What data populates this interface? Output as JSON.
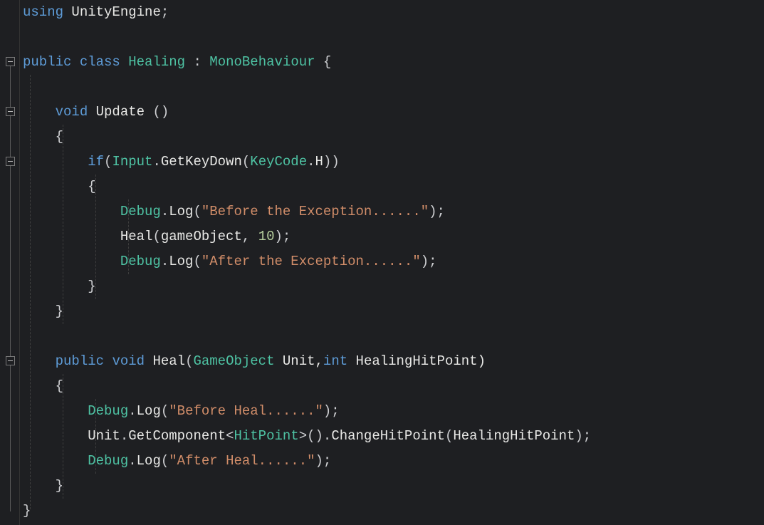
{
  "code": {
    "l1": {
      "using": "using",
      "ns": "UnityEngine",
      "semi": ";"
    },
    "l3": {
      "pub": "public",
      "cls": "class",
      "name": "Healing",
      "colon": " : ",
      "base": "MonoBehaviour",
      "open": " {"
    },
    "l5": {
      "void": "void",
      "name": "Update",
      "parens": " ()"
    },
    "l6": {
      "open": "{"
    },
    "l7": {
      "if": "if",
      "op": "(",
      "input": "Input",
      "dot1": ".",
      "gkd": "GetKeyDown",
      "op2": "(",
      "kc": "KeyCode",
      "dot2": ".",
      "h": "H",
      "close": "))"
    },
    "l8": {
      "open": "{"
    },
    "l9": {
      "dbg": "Debug",
      "dot": ".",
      "log": "Log",
      "op": "(",
      "str": "\"Before the Exception......\"",
      "close": ");"
    },
    "l10": {
      "heal": "Heal",
      "op": "(",
      "go": "gameObject",
      "comma": ", ",
      "num": "10",
      "close": ");"
    },
    "l11": {
      "dbg": "Debug",
      "dot": ".",
      "log": "Log",
      "op": "(",
      "str": "\"After the Exception......\"",
      "close": ");"
    },
    "l12": {
      "close": "}"
    },
    "l13": {
      "close": "}"
    },
    "l15": {
      "pub": "public",
      "void": "void",
      "name": "Heal",
      "op": "(",
      "gotype": "GameObject",
      "p1": " Unit,",
      "inttype": "int",
      "p2": " HealingHitPoint)"
    },
    "l16": {
      "open": "{"
    },
    "l17": {
      "dbg": "Debug",
      "dot": ".",
      "log": "Log",
      "op": "(",
      "str": "\"Before Heal......\"",
      "close": ");"
    },
    "l18": {
      "unit": "Unit",
      "dot1": ".",
      "gc": "GetComponent",
      "lt": "<",
      "hp": "HitPoint",
      "gt": ">",
      "parens": "()",
      "dot2": ".",
      "chp": "ChangeHitPoint",
      "op": "(",
      "arg": "HealingHitPoint",
      "close": ");"
    },
    "l19": {
      "dbg": "Debug",
      "dot": ".",
      "log": "Log",
      "op": "(",
      "str": "\"After Heal......\"",
      "close": ");"
    },
    "l20": {
      "close": "}"
    },
    "l21": {
      "close": "}"
    }
  }
}
